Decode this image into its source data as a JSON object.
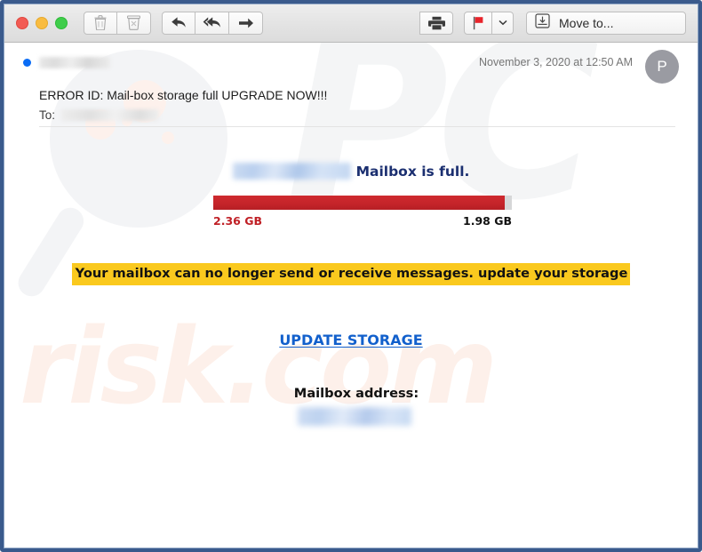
{
  "window": {
    "frame_color": "#3a5a8c",
    "traffic_lights": [
      {
        "name": "close",
        "color": "#f25b54"
      },
      {
        "name": "minimize",
        "color": "#f9bc40"
      },
      {
        "name": "maximize",
        "color": "#3fcd4b"
      }
    ]
  },
  "toolbar": {
    "delete_label": "Delete",
    "archive_label": "Archive",
    "reply_label": "Reply",
    "reply_all_label": "Reply All",
    "forward_label": "Forward",
    "print_label": "Print",
    "flag_label": "Flag",
    "flag_color": "#e8232a",
    "flag_dropdown_label": "Flag options",
    "move_to_label": "Move to..."
  },
  "message": {
    "sender_redacted": "",
    "date": "November 3, 2020 at 12:50 AM",
    "avatar_initial": "P",
    "subject": "ERROR ID: Mail-box storage full UPGRADE NOW!!!",
    "to_label": "To:",
    "to_redacted": ""
  },
  "body": {
    "brand_redacted": "",
    "headline": "Mailbox is full.",
    "headline_color": "#1b2f70",
    "storage": {
      "used_label": "2.36 GB",
      "total_label": "1.98 GB",
      "used_color": "#c02026",
      "bar_color": "#c5242a",
      "fill_percent": 97.5
    },
    "warning": "Your mailbox can no longer send or receive messages. update your storage",
    "warning_highlight_color": "#fac91e",
    "cta_label": "UPDATE STORAGE",
    "cta_color": "#1260cc",
    "address_title": "Mailbox address:",
    "address_redacted": ""
  },
  "watermarks": {
    "logo_text": "PC",
    "site_text": "risk.com"
  }
}
